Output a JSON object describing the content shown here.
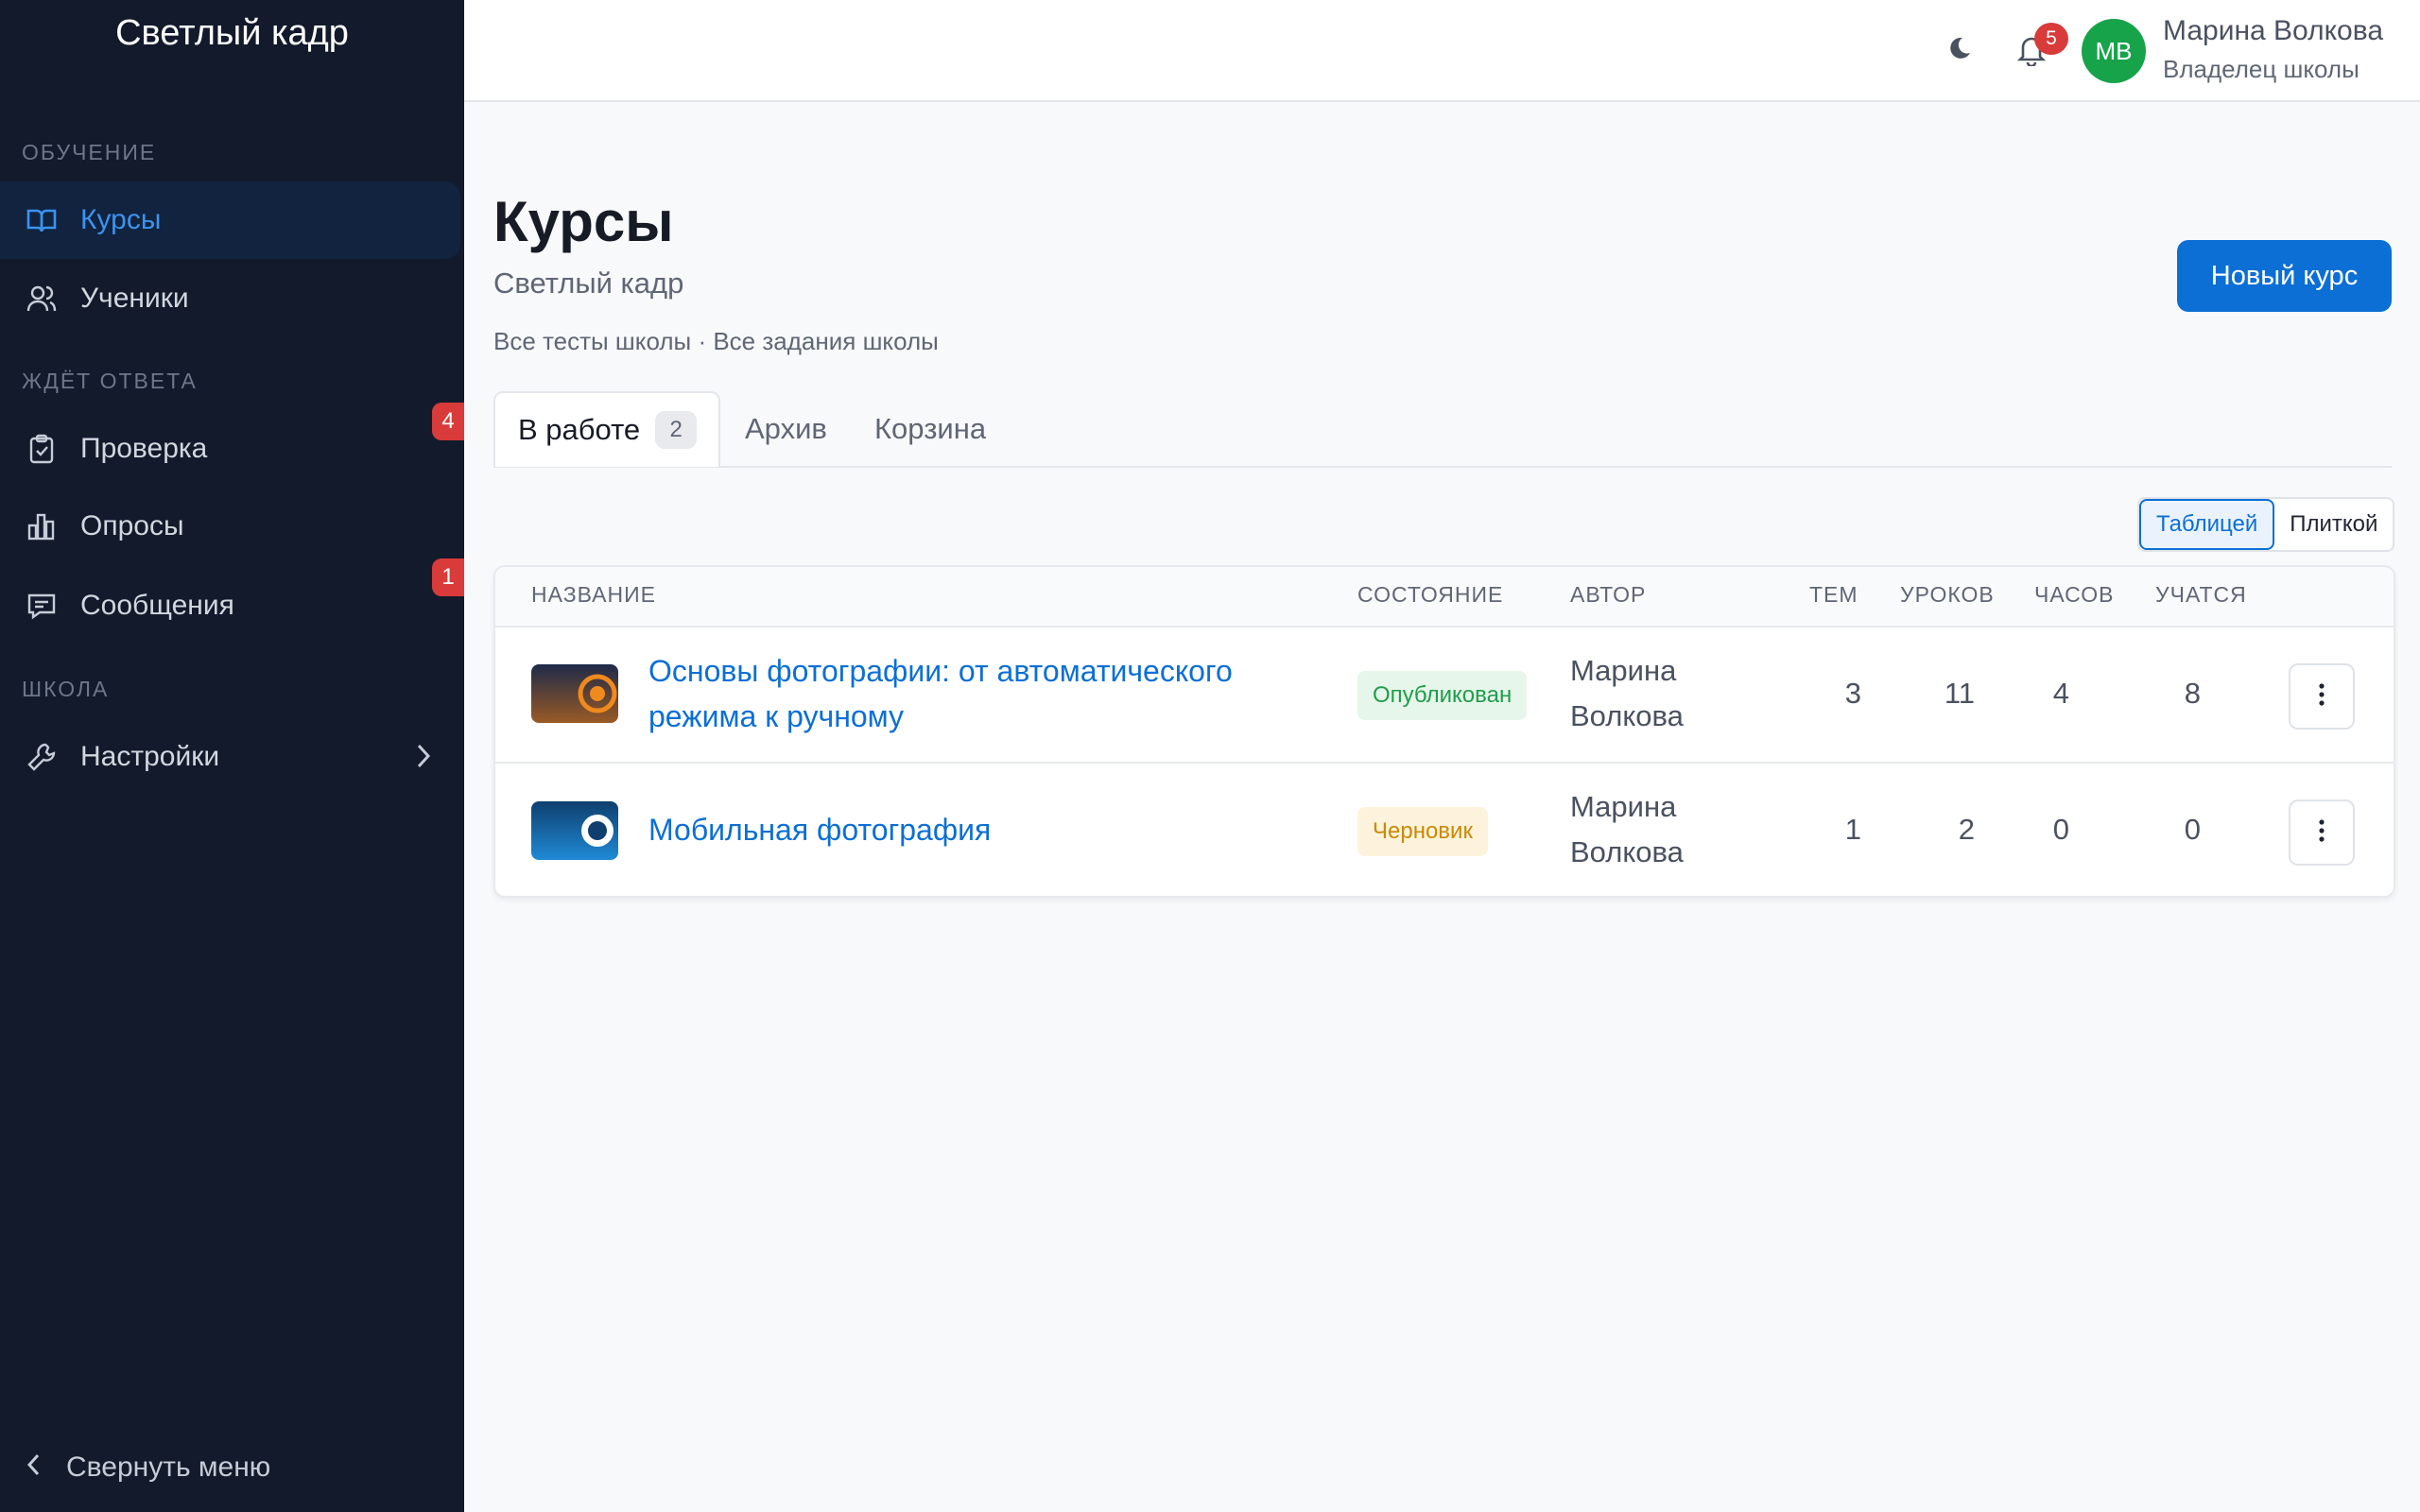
{
  "sidebar": {
    "brand": "Светлый кадр",
    "sections": [
      {
        "label": "ОБУЧЕНИЕ"
      },
      {
        "label": "ЖДЁТ ОТВЕТА"
      },
      {
        "label": "ШКОЛА"
      }
    ],
    "items": [
      {
        "label": "Курсы",
        "icon": "book-icon",
        "active": true
      },
      {
        "label": "Ученики",
        "icon": "users-icon"
      },
      {
        "label": "Проверка",
        "icon": "clipboard-check-icon",
        "badge": "4"
      },
      {
        "label": "Опросы",
        "icon": "bar-chart-icon"
      },
      {
        "label": "Сообщения",
        "icon": "message-icon",
        "badge": "1"
      },
      {
        "label": "Настройки",
        "icon": "wrench-icon"
      }
    ],
    "collapse_label": "Свернуть меню"
  },
  "header": {
    "notifications_count": "5",
    "user": {
      "initials": "МВ",
      "name": "Марина Волкова",
      "role": "Владелец школы"
    }
  },
  "page": {
    "title": "Курсы",
    "subtitle": "Светлый кадр",
    "link_tests": "Все тесты школы",
    "separator": "·",
    "link_tasks": "Все задания школы",
    "new_button": "Новый курс",
    "tabs": [
      {
        "label": "В работе",
        "count": "2",
        "active": true
      },
      {
        "label": "Архив"
      },
      {
        "label": "Корзина"
      }
    ],
    "view_options": [
      "Таблицей",
      "Плиткой"
    ]
  },
  "table": {
    "columns": [
      "НАЗВАНИЕ",
      "СОСТОЯНИЕ",
      "АВТОР",
      "ТЕМ",
      "УРОКОВ",
      "ЧАСОВ",
      "УЧАТСЯ"
    ],
    "rows": [
      {
        "title_line1": "Основы фотографии: от автоматического",
        "title_line2": "режима к ручному",
        "status": "Опубликован",
        "author_line1": "Марина",
        "author_line2": "Волкова",
        "topics": "3",
        "lessons": "11",
        "hours": "4",
        "students": "8"
      },
      {
        "title_line1": "Мобильная фотография",
        "status": "Черновик",
        "author_line1": "Марина",
        "author_line2": "Волкова",
        "topics": "1",
        "lessons": "2",
        "hours": "0",
        "students": "0"
      }
    ]
  },
  "colors": {
    "sidebar_bg": "#121a2c",
    "accent": "#0b6fd6",
    "published_bg": "#e6f6ea",
    "published_text": "#1f9d4a",
    "draft_bg": "#fdf3dc",
    "draft_text": "#c98a00",
    "badge_red": "#d93a3a"
  }
}
